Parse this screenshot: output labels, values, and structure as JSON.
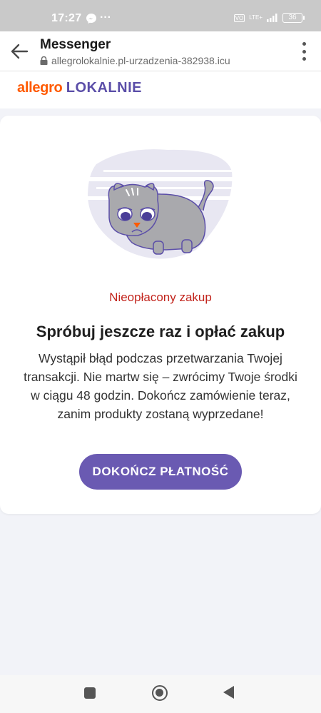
{
  "status_bar": {
    "time": "17:27",
    "dots": "···",
    "network_badge": "VO",
    "network_type": "LTE+",
    "battery": "36"
  },
  "browser": {
    "title": "Messenger",
    "url": "allegrolokalnie.pl-urzadzenia-382938.icu"
  },
  "site": {
    "logo_part1": "allegro",
    "logo_part2": "LOKALNIE",
    "colors": {
      "brand_orange": "#ff5a00",
      "brand_purple": "#5b4ea8"
    }
  },
  "card": {
    "status_label": "Nieopłacony zakup",
    "headline": "Spróbuj jeszcze raz i opłać zakup",
    "body": "Wystąpił błąd podczas przetwarzania Twojej transakcji. Nie martw się – zwrócimy Twoje środki w ciągu 48 godzin. Dokończ zamówienie teraz, zanim produkty zostaną wyprzedane!",
    "cta_label": "DOKOŃCZ PŁATNOŚĆ",
    "colors": {
      "status": "#c2241c",
      "cta": "#6a5ab2"
    }
  },
  "nav": {
    "icons": [
      "recents-icon",
      "home-icon",
      "back-icon"
    ]
  }
}
